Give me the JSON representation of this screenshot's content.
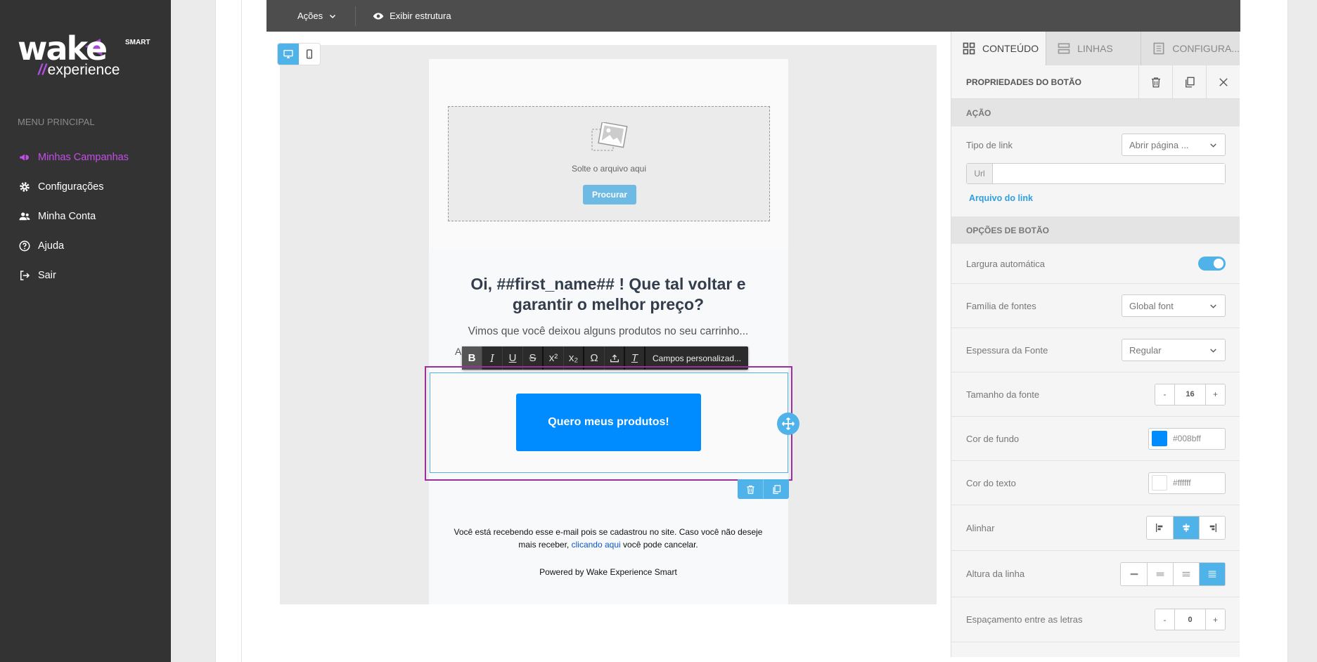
{
  "brand": {
    "logo_main": "wake",
    "logo_sub": "experience",
    "logo_slashes": "//",
    "logo_badge": "SMART"
  },
  "sidebar": {
    "menu_title": "MENU PRINCIPAL",
    "items": [
      {
        "label": "Minhas Campanhas",
        "icon": "megaphone-icon",
        "active": true
      },
      {
        "label": "Configurações",
        "icon": "gear-icon"
      },
      {
        "label": "Minha Conta",
        "icon": "users-icon"
      },
      {
        "label": "Ajuda",
        "icon": "help-circle-icon"
      },
      {
        "label": "Sair",
        "icon": "logout-icon"
      }
    ]
  },
  "topbar": {
    "actions_label": "Ações",
    "structure_label": "Exibir estrutura"
  },
  "editor": {
    "dropzone_text": "Solte o arquivo aqui",
    "dropzone_button": "Procurar",
    "headline": "Oi, ##first_name## ! Que tal voltar e garantir o melhor preço?",
    "subtext": "Vimos que você deixou alguns produtos no seu carrinho...",
    "hidden_letter": "A",
    "toolbar_custom_fields": "Campos personalizad...",
    "cta_label": "Quero meus produtos!",
    "footer_text_1": "Você está recebendo esse e-mail pois se cadastrou no site. Caso você não deseje mais receber,",
    "footer_link": "clicando aqui",
    "footer_text_2": "você pode cancelar.",
    "powered": "Powered by Wake Experience Smart"
  },
  "panel": {
    "tabs": [
      {
        "label": "CONTEÚDO",
        "active": true
      },
      {
        "label": "LINHAS"
      },
      {
        "label": "CONFIGURA..."
      }
    ],
    "title": "PROPRIEDADES DO BOTÃO",
    "section_action": "AÇÃO",
    "link_type_label": "Tipo de link",
    "link_type_value": "Abrir página ...",
    "url_label": "Url",
    "url_value": "",
    "link_file": "Arquivo do link",
    "section_options": "OPÇÕES DE BOTÃO",
    "auto_width_label": "Largura automática",
    "font_family_label": "Família de fontes",
    "font_family_value": "Global font",
    "font_weight_label": "Espessura da Fonte",
    "font_weight_value": "Regular",
    "font_size_label": "Tamanho da fonte",
    "font_size_value": "16",
    "bg_color_label": "Cor de fundo",
    "bg_color_value": "#008bff",
    "text_color_label": "Cor do texto",
    "text_color_value": "#ffffff",
    "align_label": "Alinhar",
    "line_height_label": "Altura da linha",
    "letter_spacing_label": "Espaçamento entre as letras",
    "letter_spacing_value": "0",
    "minus": "-",
    "plus": "+"
  },
  "colors": {
    "sidebar_bg": "#333333",
    "accent_purple": "#c34fe6",
    "accent_blue": "#4fb3ea",
    "cta_blue": "#008bff"
  }
}
